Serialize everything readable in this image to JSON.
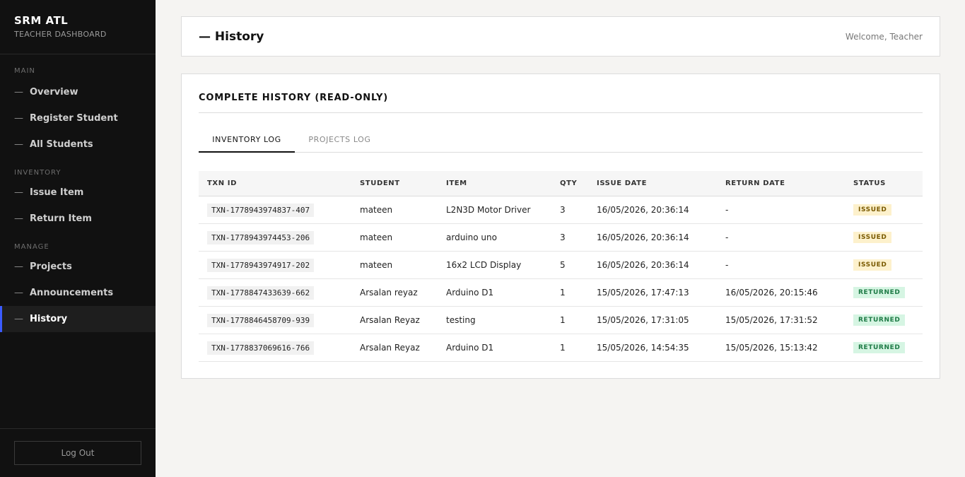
{
  "brand": {
    "title": "SRM ATL",
    "subtitle": "TEACHER DASHBOARD"
  },
  "sidebar": {
    "sections": [
      {
        "label": "MAIN",
        "items": [
          "Overview",
          "Register Student",
          "All Students"
        ]
      },
      {
        "label": "INVENTORY",
        "items": [
          "Issue Item",
          "Return Item"
        ]
      },
      {
        "label": "MANAGE",
        "items": [
          "Projects",
          "Announcements",
          "History"
        ]
      }
    ],
    "dash": "—",
    "logout_label": "Log Out"
  },
  "header": {
    "title": "— History",
    "welcome": "Welcome, Teacher"
  },
  "card": {
    "title": "COMPLETE HISTORY (READ-ONLY)",
    "tabs": [
      {
        "label": "INVENTORY LOG",
        "active": true
      },
      {
        "label": "PROJECTS LOG",
        "active": false
      }
    ]
  },
  "table": {
    "columns": [
      "TXN ID",
      "STUDENT",
      "ITEM",
      "QTY",
      "ISSUE DATE",
      "RETURN DATE",
      "STATUS"
    ],
    "rows": [
      {
        "txn": "TXN-1778943974837-407",
        "student": "mateen",
        "item": "L2N3D Motor Driver",
        "qty": "3",
        "issue": "16/05/2026, 20:36:14",
        "return": "-",
        "status": "ISSUED"
      },
      {
        "txn": "TXN-1778943974453-206",
        "student": "mateen",
        "item": "arduino uno",
        "qty": "3",
        "issue": "16/05/2026, 20:36:14",
        "return": "-",
        "status": "ISSUED"
      },
      {
        "txn": "TXN-1778943974917-202",
        "student": "mateen",
        "item": "16x2 LCD Display",
        "qty": "5",
        "issue": "16/05/2026, 20:36:14",
        "return": "-",
        "status": "ISSUED"
      },
      {
        "txn": "TXN-1778847433639-662",
        "student": "Arsalan reyaz",
        "item": "Arduino D1",
        "qty": "1",
        "issue": "15/05/2026, 17:47:13",
        "return": "16/05/2026, 20:15:46",
        "status": "RETURNED"
      },
      {
        "txn": "TXN-1778846458709-939",
        "student": "Arsalan Reyaz",
        "item": "testing",
        "qty": "1",
        "issue": "15/05/2026, 17:31:05",
        "return": "15/05/2026, 17:31:52",
        "status": "RETURNED"
      },
      {
        "txn": "TXN-1778837069616-766",
        "student": "Arsalan Reyaz",
        "item": "Arduino D1",
        "qty": "1",
        "issue": "15/05/2026, 14:54:35",
        "return": "15/05/2026, 15:13:42",
        "status": "RETURNED"
      }
    ]
  }
}
